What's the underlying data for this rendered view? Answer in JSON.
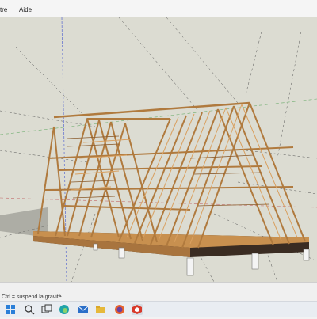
{
  "menubar": {
    "items": [
      "tre",
      "Aide"
    ]
  },
  "statusbar": {
    "hint": "Ctrl = suspend la gravité."
  },
  "taskbar": {
    "apps": [
      {
        "name": "windows-start-icon",
        "color": "#2b7fd8"
      },
      {
        "name": "search-icon",
        "color": "#3b3b3b"
      },
      {
        "name": "task-view-icon",
        "color": "#3b3b3b"
      },
      {
        "name": "edge-icon",
        "color": "#1fa3a8"
      },
      {
        "name": "mail-icon",
        "color": "#2a6fc9"
      },
      {
        "name": "file-explorer-icon",
        "color": "#e6b93b"
      },
      {
        "name": "firefox-icon",
        "color": "#e8632b"
      },
      {
        "name": "sketchup-icon",
        "color": "#d83a2b"
      }
    ]
  },
  "colors": {
    "viewport_bg": "#d9d9cf",
    "timber": "#c8904f",
    "timber_dark": "#8a5a2b",
    "deck": "#3a2c22"
  }
}
